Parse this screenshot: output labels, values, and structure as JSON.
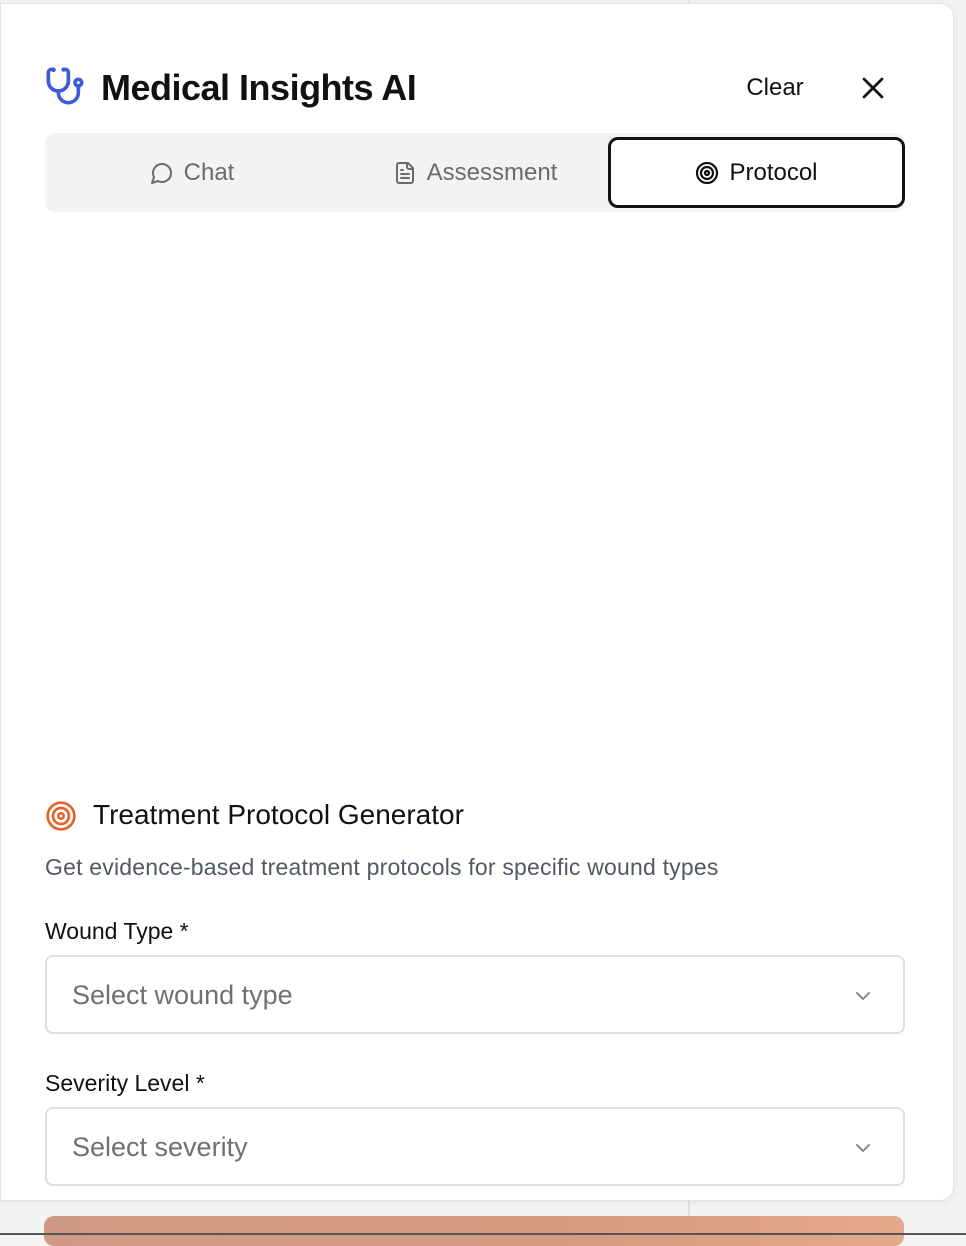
{
  "header": {
    "title": "Medical Insights AI",
    "logo_icon": "stethoscope-icon",
    "clear_label": "Clear",
    "close_icon": "close-icon"
  },
  "tabs": [
    {
      "label": "Chat",
      "icon": "message-circle-icon",
      "active": false
    },
    {
      "label": "Assessment",
      "icon": "file-text-icon",
      "active": false
    },
    {
      "label": "Protocol",
      "icon": "target-icon",
      "active": true
    }
  ],
  "protocol": {
    "title": "Treatment Protocol Generator",
    "title_icon": "target-icon",
    "description": "Get evidence-based treatment protocols for specific wound types",
    "fields": [
      {
        "label": "Wound Type *",
        "placeholder": "Select wound type"
      },
      {
        "label": "Severity Level *",
        "placeholder": "Select severity"
      }
    ]
  },
  "colors": {
    "brand_blue": "#3b5bdb",
    "accent_orange": "#e0652b",
    "generate_button": "#d49b80",
    "active_tab_border": "#111111"
  }
}
